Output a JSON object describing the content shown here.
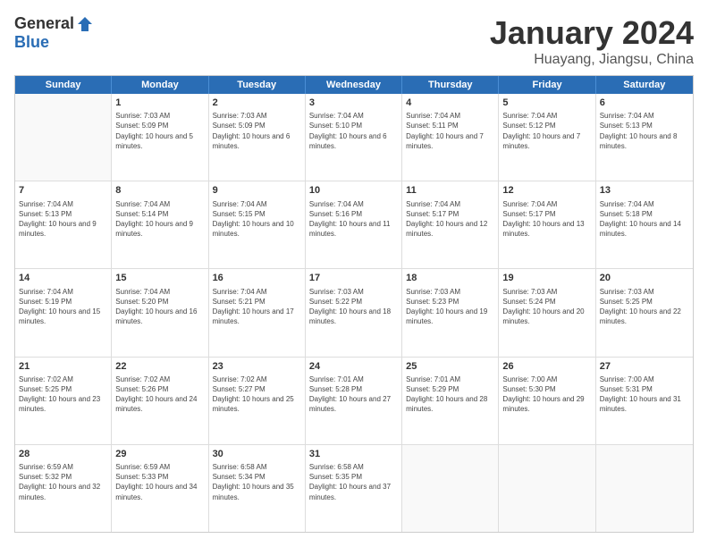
{
  "logo": {
    "general": "General",
    "blue": "Blue"
  },
  "header": {
    "month": "January 2024",
    "location": "Huayang, Jiangsu, China"
  },
  "days": [
    "Sunday",
    "Monday",
    "Tuesday",
    "Wednesday",
    "Thursday",
    "Friday",
    "Saturday"
  ],
  "weeks": [
    [
      {
        "day": "",
        "sunrise": "",
        "sunset": "",
        "daylight": ""
      },
      {
        "day": "1",
        "sunrise": "Sunrise: 7:03 AM",
        "sunset": "Sunset: 5:09 PM",
        "daylight": "Daylight: 10 hours and 5 minutes."
      },
      {
        "day": "2",
        "sunrise": "Sunrise: 7:03 AM",
        "sunset": "Sunset: 5:09 PM",
        "daylight": "Daylight: 10 hours and 6 minutes."
      },
      {
        "day": "3",
        "sunrise": "Sunrise: 7:04 AM",
        "sunset": "Sunset: 5:10 PM",
        "daylight": "Daylight: 10 hours and 6 minutes."
      },
      {
        "day": "4",
        "sunrise": "Sunrise: 7:04 AM",
        "sunset": "Sunset: 5:11 PM",
        "daylight": "Daylight: 10 hours and 7 minutes."
      },
      {
        "day": "5",
        "sunrise": "Sunrise: 7:04 AM",
        "sunset": "Sunset: 5:12 PM",
        "daylight": "Daylight: 10 hours and 7 minutes."
      },
      {
        "day": "6",
        "sunrise": "Sunrise: 7:04 AM",
        "sunset": "Sunset: 5:13 PM",
        "daylight": "Daylight: 10 hours and 8 minutes."
      }
    ],
    [
      {
        "day": "7",
        "sunrise": "Sunrise: 7:04 AM",
        "sunset": "Sunset: 5:13 PM",
        "daylight": "Daylight: 10 hours and 9 minutes."
      },
      {
        "day": "8",
        "sunrise": "Sunrise: 7:04 AM",
        "sunset": "Sunset: 5:14 PM",
        "daylight": "Daylight: 10 hours and 9 minutes."
      },
      {
        "day": "9",
        "sunrise": "Sunrise: 7:04 AM",
        "sunset": "Sunset: 5:15 PM",
        "daylight": "Daylight: 10 hours and 10 minutes."
      },
      {
        "day": "10",
        "sunrise": "Sunrise: 7:04 AM",
        "sunset": "Sunset: 5:16 PM",
        "daylight": "Daylight: 10 hours and 11 minutes."
      },
      {
        "day": "11",
        "sunrise": "Sunrise: 7:04 AM",
        "sunset": "Sunset: 5:17 PM",
        "daylight": "Daylight: 10 hours and 12 minutes."
      },
      {
        "day": "12",
        "sunrise": "Sunrise: 7:04 AM",
        "sunset": "Sunset: 5:17 PM",
        "daylight": "Daylight: 10 hours and 13 minutes."
      },
      {
        "day": "13",
        "sunrise": "Sunrise: 7:04 AM",
        "sunset": "Sunset: 5:18 PM",
        "daylight": "Daylight: 10 hours and 14 minutes."
      }
    ],
    [
      {
        "day": "14",
        "sunrise": "Sunrise: 7:04 AM",
        "sunset": "Sunset: 5:19 PM",
        "daylight": "Daylight: 10 hours and 15 minutes."
      },
      {
        "day": "15",
        "sunrise": "Sunrise: 7:04 AM",
        "sunset": "Sunset: 5:20 PM",
        "daylight": "Daylight: 10 hours and 16 minutes."
      },
      {
        "day": "16",
        "sunrise": "Sunrise: 7:04 AM",
        "sunset": "Sunset: 5:21 PM",
        "daylight": "Daylight: 10 hours and 17 minutes."
      },
      {
        "day": "17",
        "sunrise": "Sunrise: 7:03 AM",
        "sunset": "Sunset: 5:22 PM",
        "daylight": "Daylight: 10 hours and 18 minutes."
      },
      {
        "day": "18",
        "sunrise": "Sunrise: 7:03 AM",
        "sunset": "Sunset: 5:23 PM",
        "daylight": "Daylight: 10 hours and 19 minutes."
      },
      {
        "day": "19",
        "sunrise": "Sunrise: 7:03 AM",
        "sunset": "Sunset: 5:24 PM",
        "daylight": "Daylight: 10 hours and 20 minutes."
      },
      {
        "day": "20",
        "sunrise": "Sunrise: 7:03 AM",
        "sunset": "Sunset: 5:25 PM",
        "daylight": "Daylight: 10 hours and 22 minutes."
      }
    ],
    [
      {
        "day": "21",
        "sunrise": "Sunrise: 7:02 AM",
        "sunset": "Sunset: 5:25 PM",
        "daylight": "Daylight: 10 hours and 23 minutes."
      },
      {
        "day": "22",
        "sunrise": "Sunrise: 7:02 AM",
        "sunset": "Sunset: 5:26 PM",
        "daylight": "Daylight: 10 hours and 24 minutes."
      },
      {
        "day": "23",
        "sunrise": "Sunrise: 7:02 AM",
        "sunset": "Sunset: 5:27 PM",
        "daylight": "Daylight: 10 hours and 25 minutes."
      },
      {
        "day": "24",
        "sunrise": "Sunrise: 7:01 AM",
        "sunset": "Sunset: 5:28 PM",
        "daylight": "Daylight: 10 hours and 27 minutes."
      },
      {
        "day": "25",
        "sunrise": "Sunrise: 7:01 AM",
        "sunset": "Sunset: 5:29 PM",
        "daylight": "Daylight: 10 hours and 28 minutes."
      },
      {
        "day": "26",
        "sunrise": "Sunrise: 7:00 AM",
        "sunset": "Sunset: 5:30 PM",
        "daylight": "Daylight: 10 hours and 29 minutes."
      },
      {
        "day": "27",
        "sunrise": "Sunrise: 7:00 AM",
        "sunset": "Sunset: 5:31 PM",
        "daylight": "Daylight: 10 hours and 31 minutes."
      }
    ],
    [
      {
        "day": "28",
        "sunrise": "Sunrise: 6:59 AM",
        "sunset": "Sunset: 5:32 PM",
        "daylight": "Daylight: 10 hours and 32 minutes."
      },
      {
        "day": "29",
        "sunrise": "Sunrise: 6:59 AM",
        "sunset": "Sunset: 5:33 PM",
        "daylight": "Daylight: 10 hours and 34 minutes."
      },
      {
        "day": "30",
        "sunrise": "Sunrise: 6:58 AM",
        "sunset": "Sunset: 5:34 PM",
        "daylight": "Daylight: 10 hours and 35 minutes."
      },
      {
        "day": "31",
        "sunrise": "Sunrise: 6:58 AM",
        "sunset": "Sunset: 5:35 PM",
        "daylight": "Daylight: 10 hours and 37 minutes."
      },
      {
        "day": "",
        "sunrise": "",
        "sunset": "",
        "daylight": ""
      },
      {
        "day": "",
        "sunrise": "",
        "sunset": "",
        "daylight": ""
      },
      {
        "day": "",
        "sunrise": "",
        "sunset": "",
        "daylight": ""
      }
    ]
  ]
}
